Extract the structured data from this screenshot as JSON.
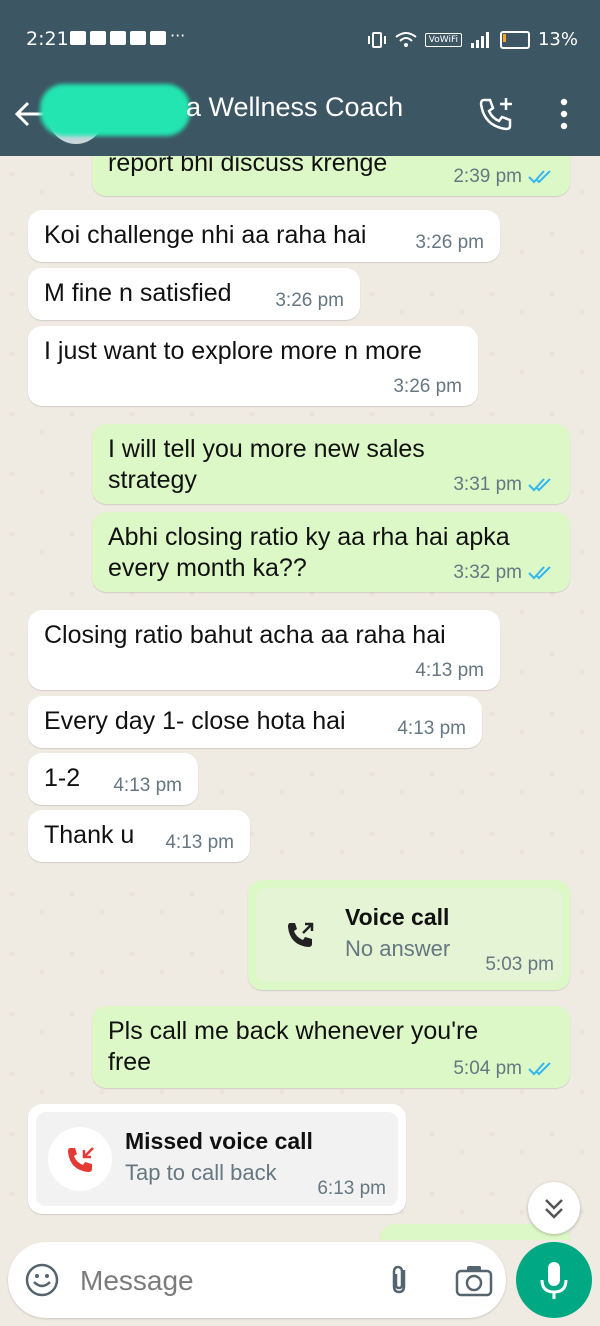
{
  "status_bar": {
    "time": "2:21",
    "dots": "···",
    "wifi_label": "VoWiFi",
    "battery": "13%",
    "battery_level": 0.13
  },
  "header": {
    "contact_name": "a Wellness Coach"
  },
  "messages": [
    {
      "text": "report bhi discuss krenge",
      "time": "2:39 pm"
    },
    {
      "text": "Koi challenge nhi aa raha hai",
      "time": "3:26 pm"
    },
    {
      "text": "M fine n satisfied",
      "time": "3:26 pm"
    },
    {
      "text": "I just want to explore more n more",
      "time": "3:26 pm"
    },
    {
      "text_line1": "I will tell you more new sales",
      "text_line2": "strategy",
      "time": "3:31 pm"
    },
    {
      "text_line1": "Abhi closing ratio ky aa rha hai apka",
      "text_line2": "every month ka??",
      "time": "3:32 pm"
    },
    {
      "text": "Closing ratio bahut acha aa raha hai",
      "time": "4:13 pm"
    },
    {
      "text": "Every day 1- close hota hai",
      "time": "4:13 pm"
    },
    {
      "text": "1-2",
      "time": "4:13 pm"
    },
    {
      "text": "Thank u",
      "time": "4:13 pm"
    },
    {
      "title": "Voice call",
      "sub": "No answer",
      "time": "5:03 pm"
    },
    {
      "text_line1": "Pls call me back whenever you're",
      "text_line2": "free",
      "time": "5:04 pm"
    },
    {
      "title": "Missed voice call",
      "sub": "Tap to call back",
      "time": "6:13 pm"
    }
  ],
  "composer": {
    "placeholder": "Message"
  },
  "colors": {
    "header": "#3c5663",
    "outgoing": "#dcf8c6",
    "incoming": "#ffffff",
    "read_ticks": "#34b7f1",
    "mic": "#00a884",
    "missed": "#e53935"
  }
}
